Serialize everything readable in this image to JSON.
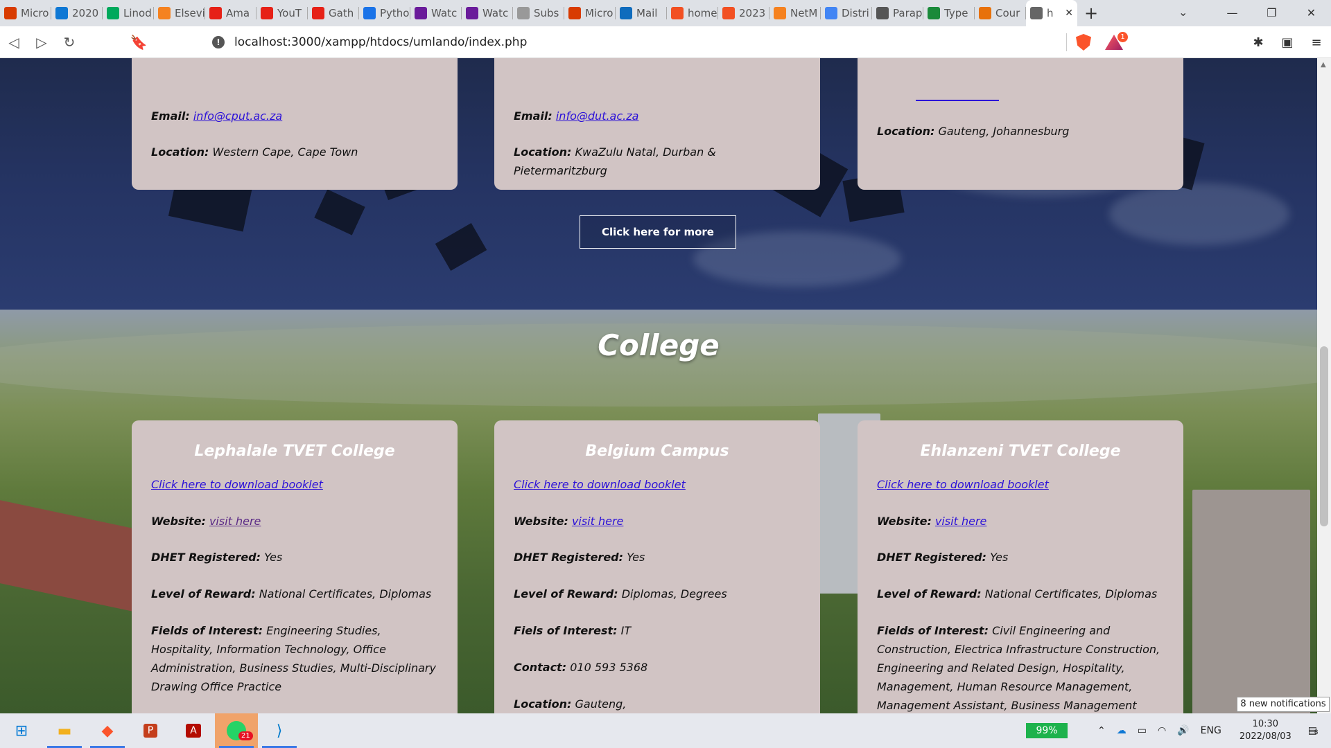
{
  "browser": {
    "tabs": [
      {
        "label": "Micro",
        "color": "#d83b01",
        "icon": "office-icon"
      },
      {
        "label": "2020",
        "color": "#0f78d4",
        "icon": "onedrive-icon"
      },
      {
        "label": "Linod",
        "color": "#00a95c",
        "icon": "linode-icon"
      },
      {
        "label": "Elsevi",
        "color": "#f58220",
        "icon": "elsevier-icon"
      },
      {
        "label": "Ama",
        "color": "#e62117",
        "icon": "youtube-icon"
      },
      {
        "label": "YouT",
        "color": "#e62117",
        "icon": "youtube-icon"
      },
      {
        "label": "Gath",
        "color": "#e62117",
        "icon": "youtube-icon"
      },
      {
        "label": "Pytho",
        "color": "#1a73e8",
        "icon": "python-icon"
      },
      {
        "label": "Watc",
        "color": "#6a1b9a",
        "icon": "play-icon"
      },
      {
        "label": "Watc",
        "color": "#6a1b9a",
        "icon": "play-icon"
      },
      {
        "label": "Subs",
        "color": "#999999",
        "icon": "doc-icon"
      },
      {
        "label": "Micro",
        "color": "#d83b01",
        "icon": "office-icon"
      },
      {
        "label": "Mail",
        "color": "#0f6cbd",
        "icon": "outlook-icon"
      },
      {
        "label": "home",
        "color": "#f25022",
        "icon": "home-icon"
      },
      {
        "label": "2023",
        "color": "#f25022",
        "icon": "calendar-icon"
      },
      {
        "label": "NetM",
        "color": "#f58220",
        "icon": "netm-icon"
      },
      {
        "label": "Distri",
        "color": "#4285f4",
        "icon": "google-icon"
      },
      {
        "label": "Parap",
        "color": "#555555",
        "icon": "quill-icon"
      },
      {
        "label": "Type",
        "color": "#1a8a3a",
        "icon": "type-icon"
      },
      {
        "label": "Cour",
        "color": "#e8710a",
        "icon": "course-icon"
      }
    ],
    "active_tab": {
      "label": "h",
      "icon": "globe-icon"
    },
    "url": "localhost:3000/xampp/htdocs/umlando/index.php",
    "rewards_badge": "1"
  },
  "university_cards": [
    {
      "email_label": "Email:",
      "email": "info@cput.ac.za",
      "location_label": "Location:",
      "location": "Western Cape, Cape Town"
    },
    {
      "email_label": "Email:",
      "email": "info@dut.ac.za",
      "location_label": "Location:",
      "location": "KwaZulu Natal, Durban & Pietermaritzburg"
    },
    {
      "location_label": "Location:",
      "location": "Gauteng, Johannesburg"
    }
  ],
  "more_button": "Click here for more",
  "college_section": {
    "title": "College",
    "cards": [
      {
        "name": "Lephalale TVET College",
        "booklet": "Click here to download booklet",
        "website_label": "Website:",
        "website_link": "visit here",
        "dhet_label": "DHET Registered:",
        "dhet": "Yes",
        "reward_label": "Level of Reward:",
        "reward": "National Certificates, Diplomas",
        "fields_label": "Fields of Interest:",
        "fields": "Engineering Studies, Hospitality, Information Technology, Office Administration, Business Studies, Multi-Disciplinary Drawing Office Practice"
      },
      {
        "name": "Belgium Campus",
        "booklet": "Click here to download booklet",
        "website_label": "Website:",
        "website_link": "visit here",
        "dhet_label": "DHET Registered:",
        "dhet": "Yes",
        "reward_label": "Level of Reward:",
        "reward": "Diplomas, Degrees",
        "fields_label": "Fiels of Interest:",
        "fields": "IT",
        "contact_label": "Contact:",
        "contact": "010 593 5368",
        "location_label": "Location:",
        "location": "Gauteng,"
      },
      {
        "name": "Ehlanzeni TVET College",
        "booklet": "Click here to download booklet",
        "website_label": "Website:",
        "website_link": "visit here",
        "dhet_label": "DHET Registered:",
        "dhet": "Yes",
        "reward_label": "Level of Reward:",
        "reward": "National Certificates, Diplomas",
        "fields_label": "Fields of Interest:",
        "fields": "Civil Engineering and Construction, Electrica Infrastructure Construction, Engineering and Related Design, Hospitality, Management, Human Resource Management, Management Assistant, Business Management"
      }
    ]
  },
  "taskbar": {
    "whatsapp_badge": "21",
    "battery": "99%",
    "lang": "ENG",
    "time": "10:30",
    "date": "2022/08/03",
    "notif_count": "8",
    "notif_tooltip": "8 new notifications"
  }
}
